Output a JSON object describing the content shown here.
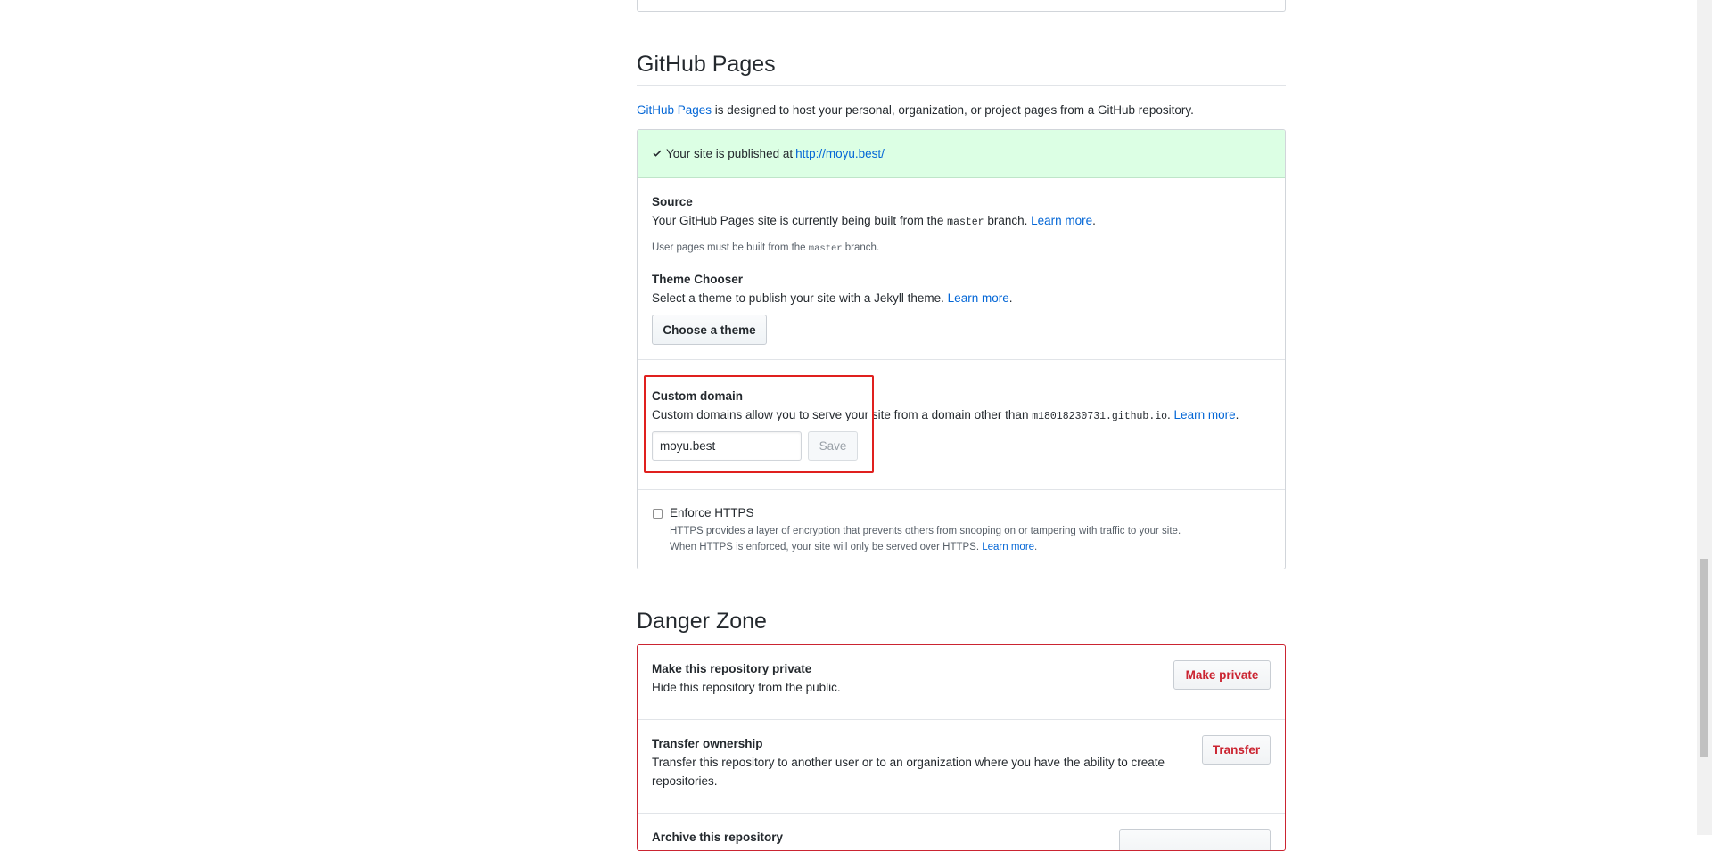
{
  "pages": {
    "title": "GitHub Pages",
    "desc_link": "GitHub Pages",
    "desc_text": " is designed to host your personal, organization, or project pages from a GitHub repository.",
    "flash_text": "Your site is published at ",
    "flash_url": "http://moyu.best/",
    "source_title": "Source",
    "source_text_1": "Your GitHub Pages site is currently being built from the ",
    "source_branch": "master",
    "source_text_2": " branch. ",
    "learn_more": "Learn more",
    "source_note_1": "User pages must be built from the ",
    "source_note_2": " branch.",
    "theme_title": "Theme Chooser",
    "theme_text": "Select a theme to publish your site with a Jekyll theme. ",
    "theme_button": "Choose a theme",
    "domain_title": "Custom domain",
    "domain_text_1": "Custom domains allow you to serve your site from a domain other than ",
    "domain_host": "m18018230731.github.io",
    "domain_text_2": ". ",
    "domain_value": "moyu.best",
    "save_button": "Save",
    "https_title": "Enforce HTTPS",
    "https_text_1": "HTTPS provides a layer of encryption that prevents others from snooping on or tampering with traffic to your site.",
    "https_text_2": "When HTTPS is enforced, your site will only be served over HTTPS. "
  },
  "danger": {
    "title": "Danger Zone",
    "private_title": "Make this repository private",
    "private_text": "Hide this repository from the public.",
    "private_button": "Make private",
    "transfer_title": "Transfer ownership",
    "transfer_text_1": "Transfer this repository to another user or to an organization where you have the ability to create",
    "transfer_text_2": "repositories.",
    "transfer_button": "Transfer",
    "archive_title": "Archive this repository"
  },
  "colors": {
    "link": "#0366d6",
    "flash_bg": "#dcffe4",
    "danger": "#cb2431",
    "highlight": "#e0201e"
  }
}
